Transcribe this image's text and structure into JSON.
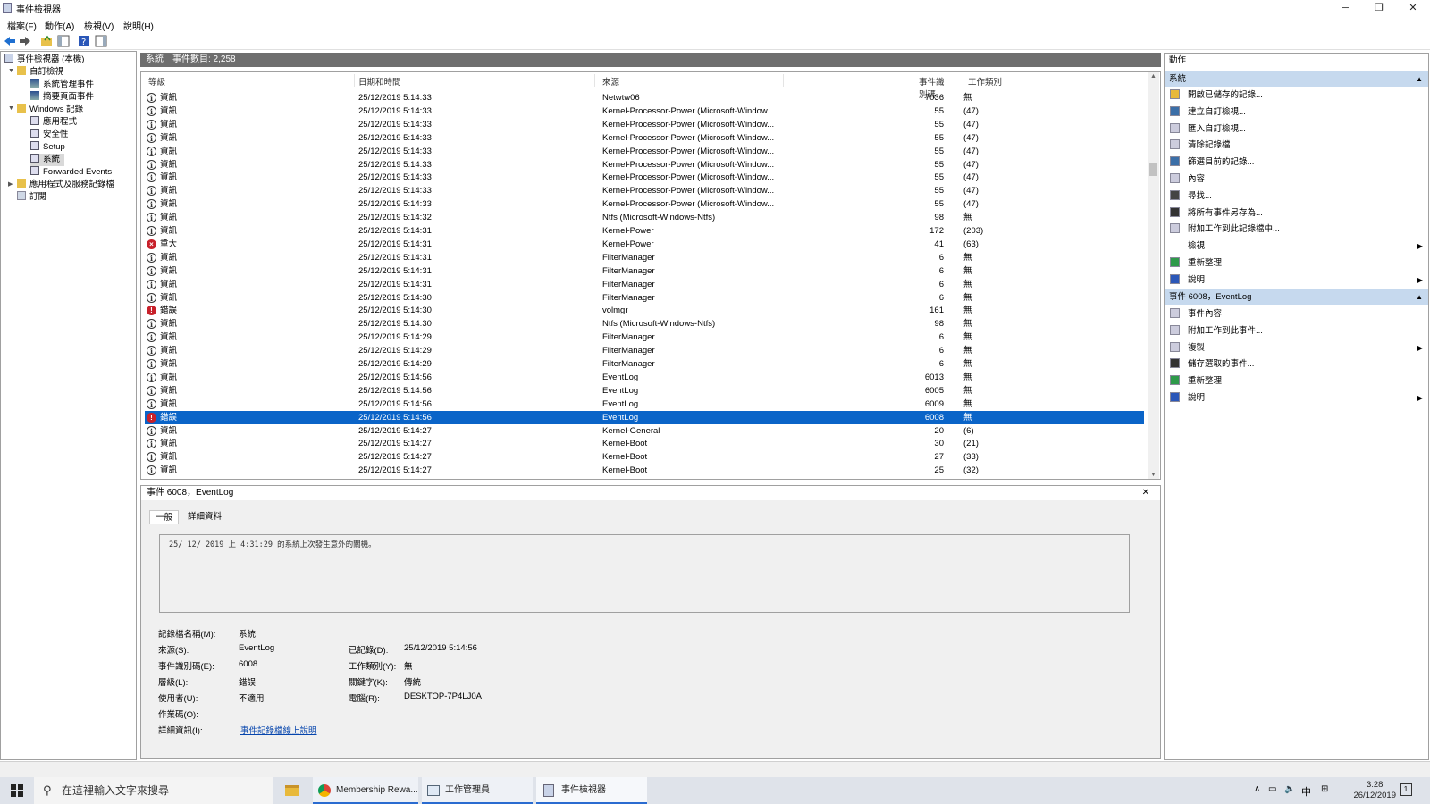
{
  "window": {
    "title": "事件檢視器",
    "minimize": "─",
    "maximize": "❐",
    "close": "✕"
  },
  "menu": {
    "file": "檔案(F)",
    "action": "動作(A)",
    "view": "檢視(V)",
    "help": "說明(H)"
  },
  "tree": {
    "root": "事件檢視器 (本機)",
    "custom_views": "自訂檢視",
    "admin_events": "系統管理事件",
    "summary_events": "摘要頁面事件",
    "windows_logs": "Windows 記錄",
    "application": "應用程式",
    "security": "安全性",
    "setup": "Setup",
    "system": "系統",
    "forwarded": "Forwarded Events",
    "app_service_logs": "應用程式及服務記錄檔",
    "subscriptions": "訂閱"
  },
  "list_header": {
    "log": "系統",
    "count_label": "事件數目: 2,258"
  },
  "columns": {
    "level": "等級",
    "datetime": "日期和時間",
    "source": "來源",
    "event_id": "事件識別碼",
    "task": "工作類別"
  },
  "rows": [
    {
      "icon": "info",
      "level": "資訊",
      "dt": "25/12/2019 5:14:33",
      "src": "Netwtw06",
      "id": "7036",
      "task": "無"
    },
    {
      "icon": "info",
      "level": "資訊",
      "dt": "25/12/2019 5:14:33",
      "src": "Kernel-Processor-Power (Microsoft-Window...",
      "id": "55",
      "task": "(47)"
    },
    {
      "icon": "info",
      "level": "資訊",
      "dt": "25/12/2019 5:14:33",
      "src": "Kernel-Processor-Power (Microsoft-Window...",
      "id": "55",
      "task": "(47)"
    },
    {
      "icon": "info",
      "level": "資訊",
      "dt": "25/12/2019 5:14:33",
      "src": "Kernel-Processor-Power (Microsoft-Window...",
      "id": "55",
      "task": "(47)"
    },
    {
      "icon": "info",
      "level": "資訊",
      "dt": "25/12/2019 5:14:33",
      "src": "Kernel-Processor-Power (Microsoft-Window...",
      "id": "55",
      "task": "(47)"
    },
    {
      "icon": "info",
      "level": "資訊",
      "dt": "25/12/2019 5:14:33",
      "src": "Kernel-Processor-Power (Microsoft-Window...",
      "id": "55",
      "task": "(47)"
    },
    {
      "icon": "info",
      "level": "資訊",
      "dt": "25/12/2019 5:14:33",
      "src": "Kernel-Processor-Power (Microsoft-Window...",
      "id": "55",
      "task": "(47)"
    },
    {
      "icon": "info",
      "level": "資訊",
      "dt": "25/12/2019 5:14:33",
      "src": "Kernel-Processor-Power (Microsoft-Window...",
      "id": "55",
      "task": "(47)"
    },
    {
      "icon": "info",
      "level": "資訊",
      "dt": "25/12/2019 5:14:33",
      "src": "Kernel-Processor-Power (Microsoft-Window...",
      "id": "55",
      "task": "(47)"
    },
    {
      "icon": "info",
      "level": "資訊",
      "dt": "25/12/2019 5:14:32",
      "src": "Ntfs (Microsoft-Windows-Ntfs)",
      "id": "98",
      "task": "無"
    },
    {
      "icon": "info",
      "level": "資訊",
      "dt": "25/12/2019 5:14:31",
      "src": "Kernel-Power",
      "id": "172",
      "task": "(203)"
    },
    {
      "icon": "crit",
      "level": "重大",
      "dt": "25/12/2019 5:14:31",
      "src": "Kernel-Power",
      "id": "41",
      "task": "(63)"
    },
    {
      "icon": "info",
      "level": "資訊",
      "dt": "25/12/2019 5:14:31",
      "src": "FilterManager",
      "id": "6",
      "task": "無"
    },
    {
      "icon": "info",
      "level": "資訊",
      "dt": "25/12/2019 5:14:31",
      "src": "FilterManager",
      "id": "6",
      "task": "無"
    },
    {
      "icon": "info",
      "level": "資訊",
      "dt": "25/12/2019 5:14:31",
      "src": "FilterManager",
      "id": "6",
      "task": "無"
    },
    {
      "icon": "info",
      "level": "資訊",
      "dt": "25/12/2019 5:14:30",
      "src": "FilterManager",
      "id": "6",
      "task": "無"
    },
    {
      "icon": "err",
      "level": "錯誤",
      "dt": "25/12/2019 5:14:30",
      "src": "volmgr",
      "id": "161",
      "task": "無"
    },
    {
      "icon": "info",
      "level": "資訊",
      "dt": "25/12/2019 5:14:30",
      "src": "Ntfs (Microsoft-Windows-Ntfs)",
      "id": "98",
      "task": "無"
    },
    {
      "icon": "info",
      "level": "資訊",
      "dt": "25/12/2019 5:14:29",
      "src": "FilterManager",
      "id": "6",
      "task": "無"
    },
    {
      "icon": "info",
      "level": "資訊",
      "dt": "25/12/2019 5:14:29",
      "src": "FilterManager",
      "id": "6",
      "task": "無"
    },
    {
      "icon": "info",
      "level": "資訊",
      "dt": "25/12/2019 5:14:29",
      "src": "FilterManager",
      "id": "6",
      "task": "無"
    },
    {
      "icon": "info",
      "level": "資訊",
      "dt": "25/12/2019 5:14:56",
      "src": "EventLog",
      "id": "6013",
      "task": "無"
    },
    {
      "icon": "info",
      "level": "資訊",
      "dt": "25/12/2019 5:14:56",
      "src": "EventLog",
      "id": "6005",
      "task": "無"
    },
    {
      "icon": "info",
      "level": "資訊",
      "dt": "25/12/2019 5:14:56",
      "src": "EventLog",
      "id": "6009",
      "task": "無"
    },
    {
      "icon": "err",
      "level": "錯誤",
      "dt": "25/12/2019 5:14:56",
      "src": "EventLog",
      "id": "6008",
      "task": "無",
      "selected": true
    },
    {
      "icon": "info",
      "level": "資訊",
      "dt": "25/12/2019 5:14:27",
      "src": "Kernel-General",
      "id": "20",
      "task": "(6)"
    },
    {
      "icon": "info",
      "level": "資訊",
      "dt": "25/12/2019 5:14:27",
      "src": "Kernel-Boot",
      "id": "30",
      "task": "(21)"
    },
    {
      "icon": "info",
      "level": "資訊",
      "dt": "25/12/2019 5:14:27",
      "src": "Kernel-Boot",
      "id": "27",
      "task": "(33)"
    },
    {
      "icon": "info",
      "level": "資訊",
      "dt": "25/12/2019 5:14:27",
      "src": "Kernel-Boot",
      "id": "25",
      "task": "(32)"
    }
  ],
  "detail": {
    "header": "事件 6008，EventLog",
    "close": "✕",
    "tab_general": "一般",
    "tab_details": "詳細資料",
    "message": "25/ 12/ 2019 上 4:31:29 的系統上次發生意外的關機。",
    "labels": {
      "log_name": "記錄檔名稱(M):",
      "source": "來源(S):",
      "event_id": "事件識別碼(E):",
      "level": "層級(L):",
      "user": "使用者(U):",
      "opcode": "作業碼(O):",
      "more_info": "詳細資訊(I):",
      "logged": "已記錄(D):",
      "task": "工作類別(Y):",
      "keywords": "關鍵字(K):",
      "computer": "電腦(R):"
    },
    "values": {
      "log_name": "系統",
      "source": "EventLog",
      "event_id": "6008",
      "level": "錯誤",
      "user": "不適用",
      "more_info": "事件記錄檔線上說明",
      "logged": "25/12/2019 5:14:56",
      "task": "無",
      "keywords": "傳統",
      "computer": "DESKTOP-7P4LJ0A"
    }
  },
  "actions": {
    "title": "動作",
    "section1": "系統",
    "items1": [
      "開啟已儲存的記錄...",
      "建立自訂檢視...",
      "匯入自訂檢視...",
      "清除記錄檔...",
      "篩選目前的記錄...",
      "內容",
      "尋找...",
      "將所有事件另存為...",
      "附加工作到此記錄檔中...",
      "檢視",
      "重新整理",
      "說明"
    ],
    "section2": "事件 6008，EventLog",
    "items2": [
      "事件內容",
      "附加工作到此事件...",
      "複製",
      "儲存選取的事件...",
      "重新整理",
      "說明"
    ]
  },
  "taskbar": {
    "search_placeholder": "在這裡輸入文字來搜尋",
    "task1": "Membership Rewa...",
    "task2": "工作管理員",
    "task3": "事件檢視器",
    "ime": "中",
    "time": "3:28",
    "date": "26/12/2019",
    "notif_count": "1"
  },
  "colors": {
    "selection": "#0a64c8",
    "section_bg": "#c6d9ee",
    "header_bg": "#6e6e6e"
  }
}
